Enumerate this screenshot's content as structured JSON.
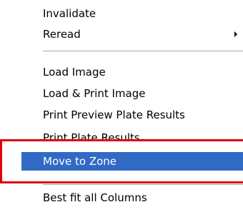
{
  "menu": {
    "items": [
      {
        "label": "Invalidate",
        "has_submenu": false,
        "selected": false
      },
      {
        "label": "Reread",
        "has_submenu": true,
        "selected": false
      },
      {
        "label": "Load Image",
        "has_submenu": false,
        "selected": false
      },
      {
        "label": "Load & Print Image",
        "has_submenu": false,
        "selected": false
      },
      {
        "label": "Print Preview Plate Results",
        "has_submenu": false,
        "selected": false
      },
      {
        "label": "Print Plate Results",
        "has_submenu": false,
        "selected": false
      },
      {
        "label": "Move to Zone",
        "has_submenu": false,
        "selected": true
      },
      {
        "label": "Best fit all Columns",
        "has_submenu": false,
        "selected": false
      }
    ],
    "selection_color": "#316ac5",
    "annotation_color": "#e0000f"
  }
}
